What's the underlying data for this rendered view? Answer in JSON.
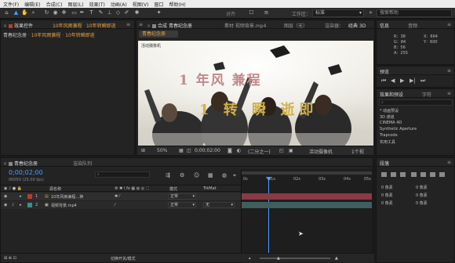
{
  "menu": [
    "文件(F)",
    "编辑(E)",
    "合成(C)",
    "图层(L)",
    "效果(T)",
    "动画(A)",
    "视图(V)",
    "窗口",
    "帮助(H)"
  ],
  "toolbar": {
    "snap_label": "对齐",
    "workspace_label": "工作区：",
    "workspace_value": "标准",
    "search_placeholder": "搜索帮助"
  },
  "project_panel": {
    "tabs": [
      "效果控件",
      "10年风雨兼程",
      "10年转瞬即逝"
    ],
    "breadcrumb": [
      "青春纪念册",
      "10年风雨兼程",
      "10年转瞬即逝"
    ]
  },
  "comp_panel": {
    "tab_comp": "合成 青春纪念册",
    "tab_footage": "素材 视频背景.mp4",
    "tab_layer": "图层（无）",
    "renderer_label": "渲染器：",
    "renderer_value": "经典 3D",
    "comp_tab": "青春纪念册",
    "camera_label": "活动摄像机",
    "overlay_line1": "1 年风 兼程",
    "overlay_line2": "1 转 瞬 逝即"
  },
  "viewer_bar": {
    "zoom": "50%",
    "timecode": "0;00;02;00",
    "resolution": "(二分之一)",
    "camera": "活动摄像机",
    "views": "1个视"
  },
  "info_panel": {
    "tabs": [
      "信息",
      "音频"
    ],
    "r": "R：38",
    "g": "G：84",
    "b": "B：56",
    "a": "A：255",
    "x": "X：664",
    "y": "Y：600"
  },
  "preview_panel": {
    "title": "预览"
  },
  "effects_panel": {
    "tabs": [
      "效果和预设",
      "字符"
    ],
    "items": [
      "* 动画预设",
      "3D 通道",
      "CINEMA 4D",
      "Synthetic Aperture",
      "Trapcode",
      "实用工具"
    ]
  },
  "timeline": {
    "tabs": [
      "青春纪念册",
      "渲染队列"
    ],
    "timecode": "0;00;02;00",
    "fps": "00050 (25.00 fps)",
    "col_source": "源名称",
    "col_mode": "模式",
    "col_trkmat": "TrkMat",
    "ruler": [
      "0s",
      "01s",
      "02s",
      "03s",
      "04s",
      "05s"
    ],
    "layers": [
      {
        "num": "1",
        "name": "10年风雨兼程…换",
        "mode": "正常",
        "trkmat": "",
        "color": "#c0392b"
      },
      {
        "num": "2",
        "name": "视频背景.mp4",
        "mode": "正常",
        "trkmat": "无",
        "color": "#3a8f8f"
      }
    ],
    "toggle_label": "切换开关/模式"
  },
  "align_panel": {
    "title": "段落",
    "values": [
      "0 像素",
      "0 像素",
      "0 像素",
      "0 像素",
      "0 像素",
      "0 像素"
    ]
  }
}
